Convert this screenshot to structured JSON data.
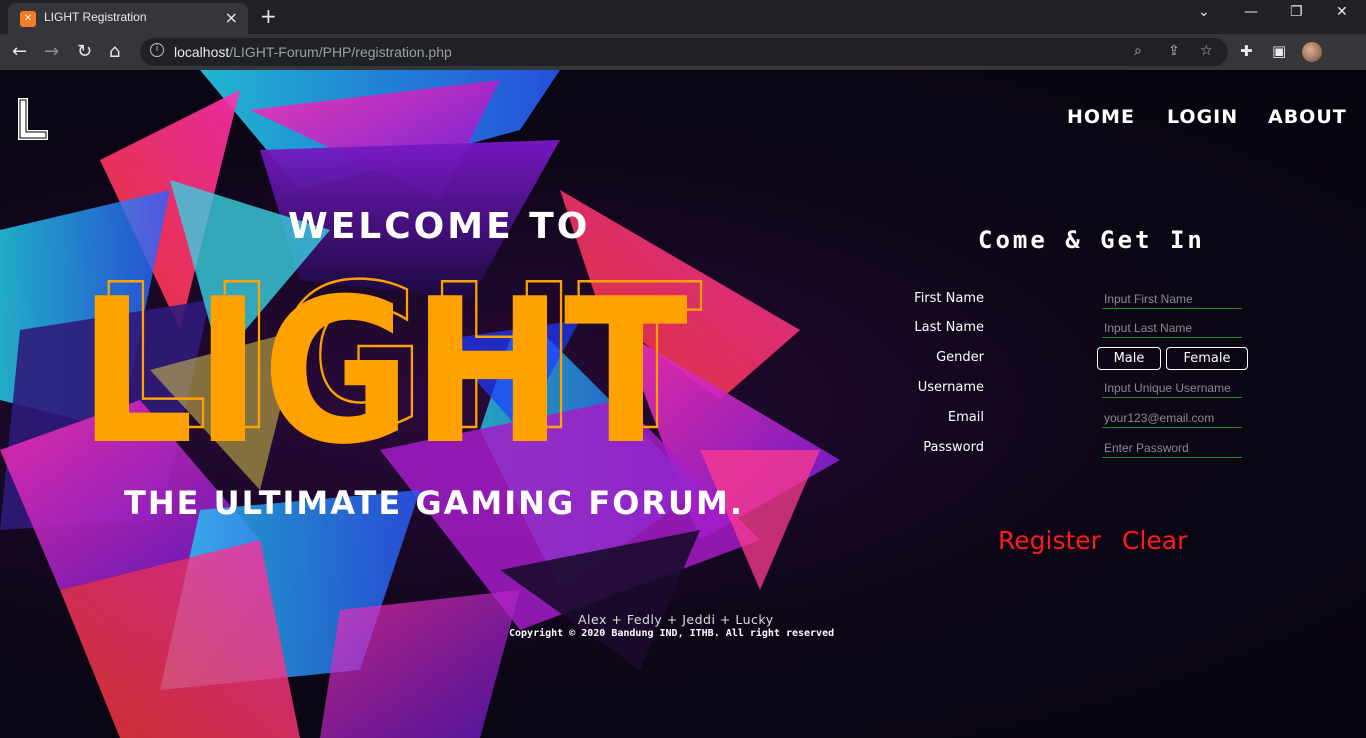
{
  "browser": {
    "tab_title": "LIGHT Registration",
    "url_host": "localhost",
    "url_path": "/LIGHT-Forum/PHP/registration.php"
  },
  "nav": {
    "home": "HOME",
    "login": "LOGIN",
    "about": "ABOUT"
  },
  "hero": {
    "welcome": "WELCOME TO",
    "brand": "LIGHT",
    "tagline": "THE ULTIMATE GAMING FORUM."
  },
  "form": {
    "title": "Come & Get In",
    "first_name_label": "First Name",
    "first_name_placeholder": "Input First Name",
    "last_name_label": "Last Name",
    "last_name_placeholder": "Input Last Name",
    "gender_label": "Gender",
    "gender_male": "Male",
    "gender_female": "Female",
    "username_label": "Username",
    "username_placeholder": "Input Unique Username",
    "email_label": "Email",
    "email_placeholder": "your123@email.com",
    "password_label": "Password",
    "password_placeholder": "Enter Password",
    "register": "Register",
    "clear": "Clear"
  },
  "footer": {
    "credits": "Alex + Fedly + Jeddi + Lucky",
    "copyright": "Copyright © 2020 Bandung IND, ITHB. All right reserved"
  },
  "colors": {
    "brand_orange": "#ffa200",
    "action_red": "#ff1a1a",
    "input_underline": "#1f8f2a"
  },
  "icons": [
    "back-arrow-icon",
    "forward-arrow-icon",
    "reload-icon",
    "home-icon",
    "info-icon",
    "zoom-icon",
    "share-icon",
    "star-icon",
    "extensions-icon",
    "sidebar-icon"
  ]
}
